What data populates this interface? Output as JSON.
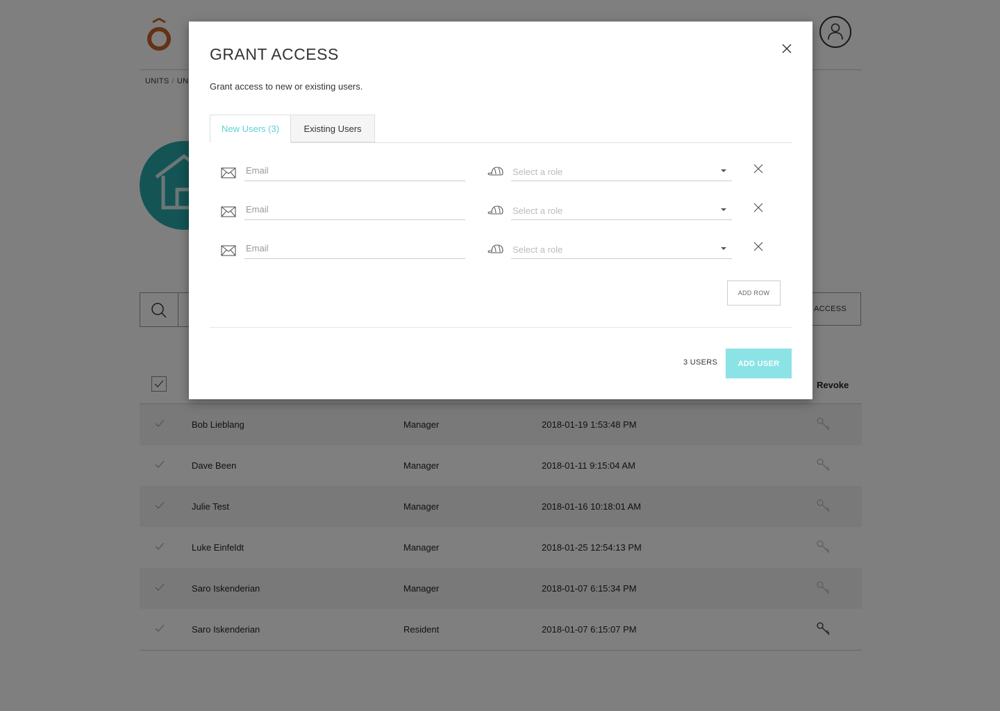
{
  "background": {
    "breadcrumb": {
      "first": "UNITS",
      "separator": "/",
      "second": "UN"
    },
    "grant_button_label": "ACCESS",
    "table_header": {
      "revoke": "Revoke"
    },
    "rows": [
      {
        "name": "Bob Lieblang",
        "role": "Manager",
        "date": "2018-01-19 1:53:48 PM"
      },
      {
        "name": "Dave Been",
        "role": "Manager",
        "date": "2018-01-11 9:15:04 AM"
      },
      {
        "name": "Julie Test",
        "role": "Manager",
        "date": "2018-01-16 10:18:01 AM"
      },
      {
        "name": "Luke Einfeldt",
        "role": "Manager",
        "date": "2018-01-25 12:54:13 PM"
      },
      {
        "name": "Saro Iskenderian",
        "role": "Manager",
        "date": "2018-01-07 6:15:34 PM"
      },
      {
        "name": "Saro Iskenderian",
        "role": "Resident",
        "date": "2018-01-07 6:15:07 PM"
      }
    ]
  },
  "modal": {
    "title": "GRANT ACCESS",
    "subtitle": "Grant access to new or existing users.",
    "tabs": [
      {
        "label": "New Users (3)",
        "active": true
      },
      {
        "label": "Existing Users",
        "active": false
      }
    ],
    "user_rows": [
      {
        "email_placeholder": "Email",
        "email_value": "",
        "role_placeholder": "Select a role"
      },
      {
        "email_placeholder": "Email",
        "email_value": "",
        "role_placeholder": "Select a role"
      },
      {
        "email_placeholder": "Email",
        "email_value": "",
        "role_placeholder": "Select a role"
      }
    ],
    "add_row_label": "ADD ROW",
    "user_count_label": "3 USERS",
    "add_user_label": "ADD USER"
  },
  "icons": {
    "logo": "o-circumflex-logo",
    "avatar": "user-avatar-icon",
    "search": "search-icon",
    "close": "close-icon",
    "mail": "mail-icon",
    "role": "hat-icon",
    "remove": "remove-icon",
    "key": "key-icon",
    "check": "check-icon"
  },
  "colors": {
    "brand_orange": "#c8632b",
    "accent_teal": "#5cd0d4",
    "add_user_bg": "#8ce3e6",
    "unit_circle": "#2aa8a8"
  }
}
